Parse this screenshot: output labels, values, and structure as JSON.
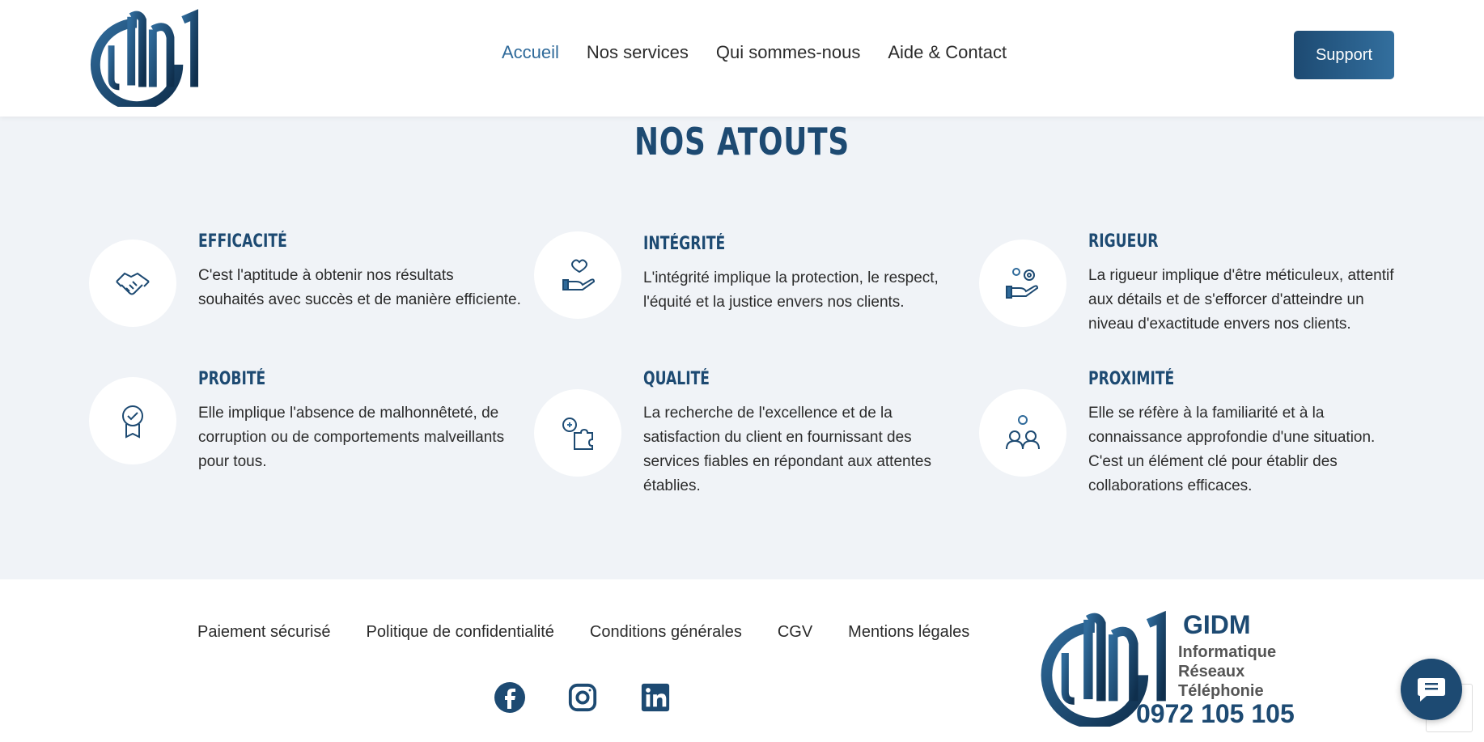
{
  "header": {
    "nav": [
      {
        "label": "Accueil",
        "active": true
      },
      {
        "label": "Nos services",
        "active": false
      },
      {
        "label": "Qui sommes-nous",
        "active": false
      },
      {
        "label": "Aide & Contact",
        "active": false
      }
    ],
    "support_label": "Support"
  },
  "atouts": {
    "title": "NOS ATOUTS",
    "items": [
      {
        "title": "EFFICACITÉ",
        "text": "C'est l'aptitude à obtenir nos résultats souhaités avec succès et de manière efficiente.",
        "icon": "handshake-icon"
      },
      {
        "title": "INTÉGRITÉ",
        "text": "L'intégrité implique la protection, le respect, l'équité et la justice envers nos clients.",
        "icon": "heart-hand-icon"
      },
      {
        "title": "RIGUEUR",
        "text": "La rigueur implique d'être méticuleux, attentif aux détails et de s'efforcer d'atteindre un niveau d'exactitude envers nos clients.",
        "icon": "gear-hand-icon"
      },
      {
        "title": "PROBITÉ",
        "text": "Elle implique l'absence de malhonnêteté, de corruption ou de comportements malveillants pour tous.",
        "icon": "award-badge-icon"
      },
      {
        "title": "QUALITÉ",
        "text": "La recherche de l'excellence et de la satisfaction du client en fournissant des services fiables en répondant aux attentes établies.",
        "icon": "idea-puzzle-icon"
      },
      {
        "title": "PROXIMITÉ",
        "text": "Elle se réfère à la familiarité et à la connaissance approfondie d'une situation. C'est un élément clé pour établir des collaborations efficaces.",
        "icon": "people-idea-icon"
      }
    ]
  },
  "footer": {
    "links": [
      "Paiement sécurisé",
      "Politique de confidentialité",
      "Conditions générales",
      "CGV",
      "Mentions légales"
    ],
    "socials": [
      "facebook-icon",
      "instagram-icon",
      "linkedin-icon"
    ],
    "brand": "GIDM",
    "tagline": [
      "Informatique",
      "Réseaux",
      "Téléphonie"
    ],
    "phone": "0972 105 105"
  },
  "colors": {
    "primary": "#1d4a72",
    "accent": "#2f6a9a",
    "section_bg": "#f0f3f7"
  }
}
